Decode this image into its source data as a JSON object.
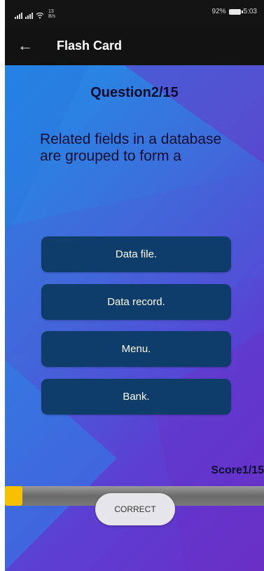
{
  "status_bar": {
    "net_speed_top": "13",
    "net_speed_bottom": "B/s",
    "battery_percent": "92%",
    "time": "5:03"
  },
  "app_bar": {
    "back_icon": "arrow-left-icon",
    "title": "Flash Card"
  },
  "quiz": {
    "question_counter": "Question2/15",
    "question_text": "Related fields in a database are grouped to form a",
    "answers": [
      "Data file.",
      "Data record.",
      "Menu.",
      "Bank."
    ],
    "score_text": "Score1/15",
    "progress_fraction": 0.067,
    "toast": "CORRECT"
  },
  "colors": {
    "answer_button": "#0e3c6b",
    "progress_fill": "#f5c000",
    "gradient_start": "#1e90e6",
    "gradient_end": "#6a2fc8"
  }
}
